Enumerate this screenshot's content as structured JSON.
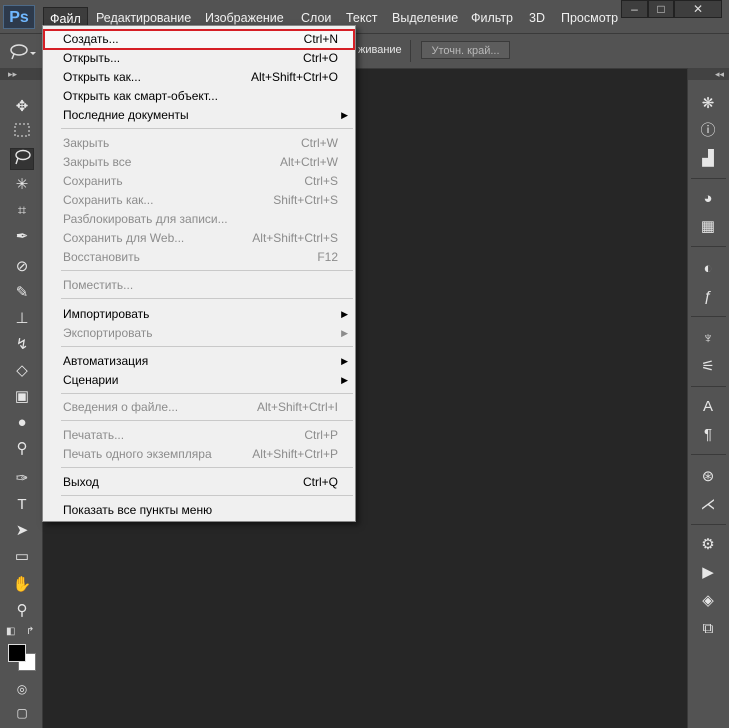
{
  "app": {
    "logo": "Ps"
  },
  "menubar": {
    "items": [
      "Файл",
      "Редактирование",
      "Изображение",
      "Слои",
      "Текст",
      "Выделение",
      "Фильтр",
      "3D",
      "Просмотр"
    ]
  },
  "window_controls": {
    "minimize": "–",
    "restore": "□",
    "close": "✕"
  },
  "options_bar": {
    "partial_text": "живание",
    "refine_button": "Уточн. край..."
  },
  "toolbar": {
    "collapse": "▸▸",
    "tools": [
      "move-tool",
      "marquee-tool",
      "lasso-tool",
      "magic-wand-tool",
      "crop-tool",
      "eyedropper-tool",
      "healing-brush-tool",
      "brush-tool",
      "clone-stamp-tool",
      "history-brush-tool",
      "eraser-tool",
      "gradient-tool",
      "blur-tool",
      "dodge-tool",
      "pen-tool",
      "type-tool",
      "path-selection-tool",
      "rectangle-tool",
      "hand-tool",
      "zoom-tool"
    ],
    "selected": "lasso-tool",
    "foreground_color": "#000000",
    "background_color": "#ffffff"
  },
  "panel_dock": {
    "collapse": "◂◂",
    "icons": [
      "navigator-icon",
      "info-icon",
      "histogram-icon",
      "swatches-icon",
      "color-grid-icon",
      "adjustments-icon",
      "styles-icon",
      "brushes-icon",
      "brush-presets-icon",
      "character-icon",
      "paragraph-icon",
      "channels-icon",
      "paths-icon",
      "tool-presets-icon",
      "actions-icon",
      "layers-icon",
      "history-icon"
    ]
  },
  "file_menu": {
    "items": [
      {
        "label": "Создать...",
        "shortcut": "Ctrl+N",
        "disabled": false,
        "submenu": false,
        "highlighted": true
      },
      {
        "label": "Открыть...",
        "shortcut": "Ctrl+O",
        "disabled": false,
        "submenu": false
      },
      {
        "label": "Открыть как...",
        "shortcut": "Alt+Shift+Ctrl+O",
        "disabled": false,
        "submenu": false
      },
      {
        "label": "Открыть как смарт-объект...",
        "shortcut": "",
        "disabled": false,
        "submenu": false
      },
      {
        "label": "Последние документы",
        "shortcut": "",
        "disabled": false,
        "submenu": true
      },
      {
        "label": "Закрыть",
        "shortcut": "Ctrl+W",
        "disabled": true,
        "submenu": false
      },
      {
        "label": "Закрыть все",
        "shortcut": "Alt+Ctrl+W",
        "disabled": true,
        "submenu": false
      },
      {
        "label": "Сохранить",
        "shortcut": "Ctrl+S",
        "disabled": true,
        "submenu": false
      },
      {
        "label": "Сохранить как...",
        "shortcut": "Shift+Ctrl+S",
        "disabled": true,
        "submenu": false
      },
      {
        "label": "Разблокировать для записи...",
        "shortcut": "",
        "disabled": true,
        "submenu": false
      },
      {
        "label": "Сохранить для Web...",
        "shortcut": "Alt+Shift+Ctrl+S",
        "disabled": true,
        "submenu": false
      },
      {
        "label": "Восстановить",
        "shortcut": "F12",
        "disabled": true,
        "submenu": false
      },
      {
        "label": "Поместить...",
        "shortcut": "",
        "disabled": true,
        "submenu": false
      },
      {
        "label": "Импортировать",
        "shortcut": "",
        "disabled": false,
        "submenu": true
      },
      {
        "label": "Экспортировать",
        "shortcut": "",
        "disabled": true,
        "submenu": true
      },
      {
        "label": "Автоматизация",
        "shortcut": "",
        "disabled": false,
        "submenu": true
      },
      {
        "label": "Сценарии",
        "shortcut": "",
        "disabled": false,
        "submenu": true
      },
      {
        "label": "Сведения о файле...",
        "shortcut": "Alt+Shift+Ctrl+I",
        "disabled": true,
        "submenu": false
      },
      {
        "label": "Печатать...",
        "shortcut": "Ctrl+P",
        "disabled": true,
        "submenu": false
      },
      {
        "label": "Печать одного экземпляра",
        "shortcut": "Alt+Shift+Ctrl+P",
        "disabled": true,
        "submenu": false
      },
      {
        "label": "Выход",
        "shortcut": "Ctrl+Q",
        "disabled": false,
        "submenu": false
      },
      {
        "label": "Показать все пункты меню",
        "shortcut": "",
        "disabled": false,
        "submenu": false
      }
    ]
  }
}
